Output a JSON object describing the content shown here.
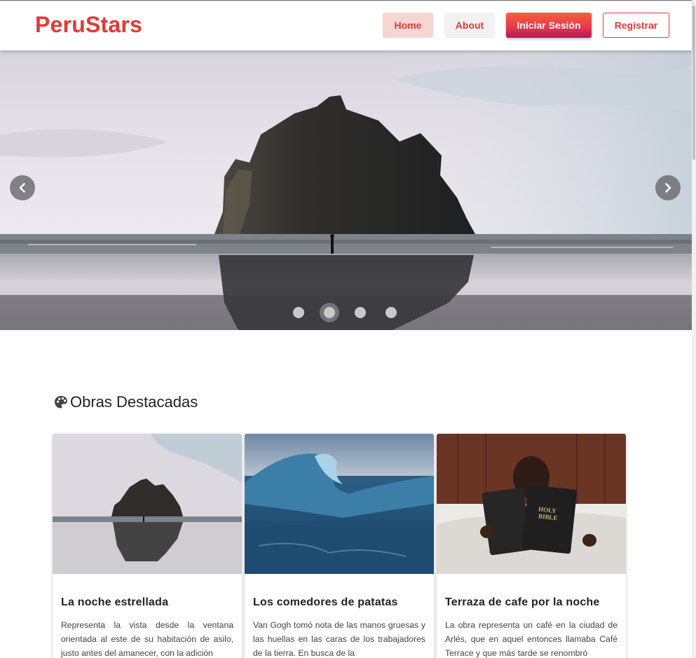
{
  "navbar": {
    "brand": "PeruStars",
    "links": {
      "home": "Home",
      "about": "About",
      "login": "Iniciar Sesión",
      "register": "Registrar"
    }
  },
  "slider": {
    "slide_count": 4,
    "active_slide": 2,
    "prev_icon": "chevron-left-icon",
    "next_icon": "chevron-right-icon"
  },
  "featured": {
    "icon": "palette-icon",
    "title": "Obras Destacadas",
    "cards": [
      {
        "title": "La noche estrellada",
        "text": "Representa la vista desde la ventana orientada al este de su habitación de asilo, justo antes del amanecer, con la adición"
      },
      {
        "title": "Los comedores de patatas",
        "text": "Van Gogh tomó nota de las manos gruesas y las huellas en las caras de los trabajadores de la tierra. En busca de la"
      },
      {
        "title": "Terraza de cafe por la noche",
        "text": "La obra representa un café en la ciudad de Arlés, que en aquel entonces llamaba Café Terrace y que más tarde se renombró"
      }
    ]
  },
  "colors": {
    "brand": "#e53935",
    "login_gradient_start": "#f7603e",
    "login_gradient_end": "#b8165c"
  }
}
